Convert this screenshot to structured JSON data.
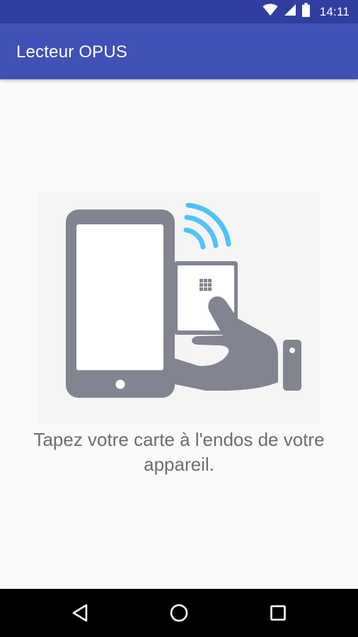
{
  "status_bar": {
    "time": "14:11",
    "icons": [
      "wifi-icon",
      "signal-icon",
      "battery-icon"
    ]
  },
  "app_bar": {
    "title": "Lecteur OPUS"
  },
  "main": {
    "illustration": "phone-card-tap-illustration",
    "instruction": "Tapez votre carte à l'endos de votre appareil."
  },
  "nav_bar": {
    "buttons": [
      "back-icon",
      "home-icon",
      "recents-icon"
    ]
  },
  "colors": {
    "status_bar": "#303f9f",
    "app_bar": "#3f51b5",
    "background": "#fafafa",
    "illustration_gray": "#80858f",
    "nfc_waves": "#4fc3f7",
    "instruction_text": "#6d6d6d"
  }
}
